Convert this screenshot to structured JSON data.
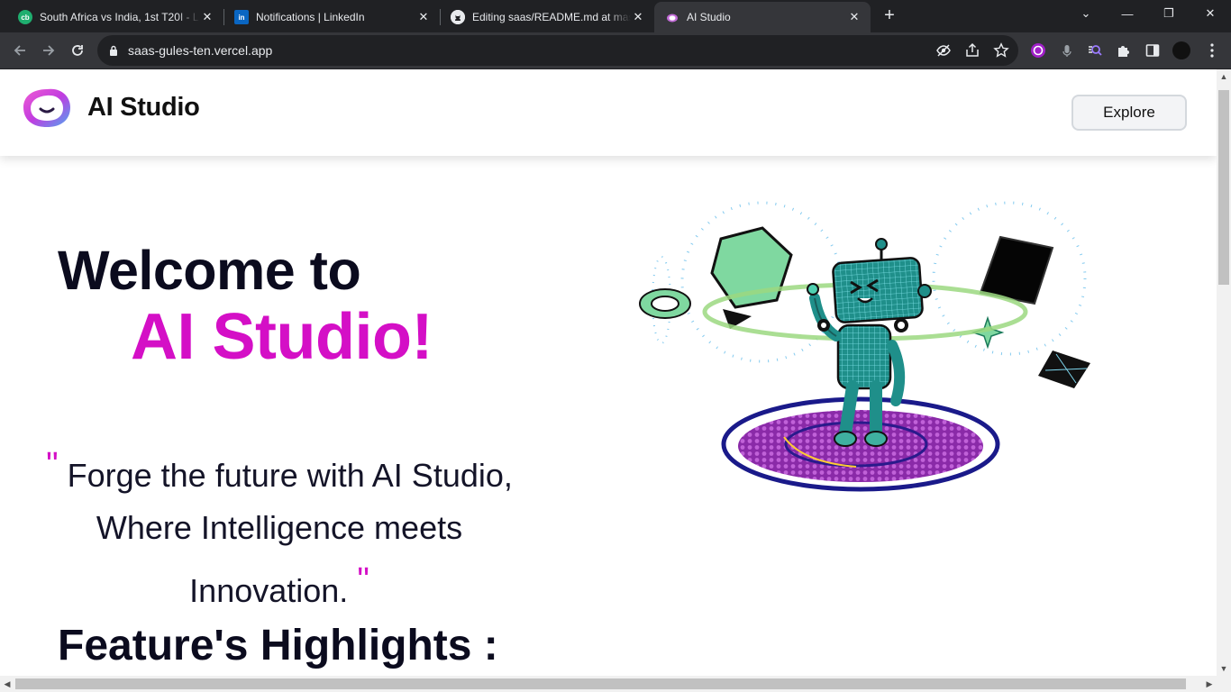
{
  "browser": {
    "tabs": [
      {
        "title": "South Africa vs India, 1st T20I - L",
        "favicon": "cricbuzz-icon",
        "fav_color": "#1fae6f",
        "fav_text": "cb",
        "active": false
      },
      {
        "title": "Notifications | LinkedIn",
        "favicon": "linkedin-icon",
        "fav_color": "#0a66c2",
        "fav_text": "in",
        "active": false
      },
      {
        "title": "Editing saas/README.md at mas",
        "favicon": "github-icon",
        "fav_color": "#ffffff",
        "fav_text": "",
        "active": false
      },
      {
        "title": "AI Studio",
        "favicon": "ai-studio-icon",
        "fav_color": "#c26bd8",
        "fav_text": "",
        "active": true
      }
    ],
    "url": "saas-gules-ten.vercel.app"
  },
  "header": {
    "brand_name": "AI Studio",
    "explore_label": "Explore"
  },
  "hero": {
    "line1": "Welcome to",
    "line2": "AI Studio!",
    "quote_open": "\"",
    "quote_line1": "Forge the future with AI Studio,",
    "quote_line2": "Where Intelligence meets",
    "quote_line3": "Innovation.",
    "quote_close": "\"",
    "features_heading": "Feature's Highlights :"
  },
  "colors": {
    "accent": "#d40fc6",
    "heading": "#0b0b1e",
    "chrome_bg": "#202124",
    "toolbar_bg": "#35363a"
  }
}
